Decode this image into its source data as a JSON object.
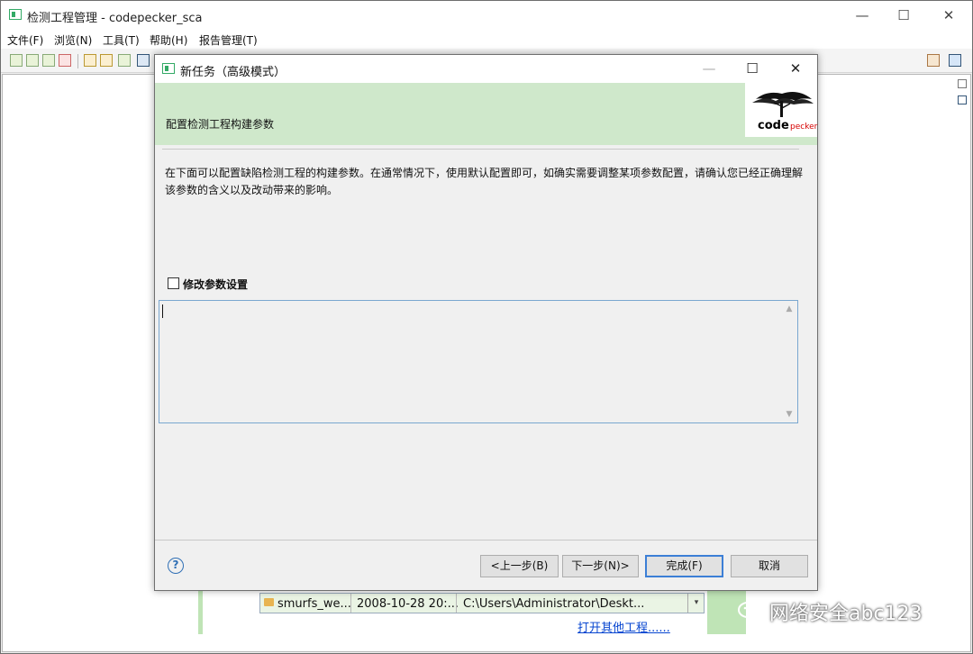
{
  "window": {
    "title": "检测工程管理 - codepecker_sca",
    "minimize_glyph": "—",
    "maximize_glyph": "☐",
    "close_glyph": "✕"
  },
  "menubar": {
    "items": [
      "文件(F)",
      "浏览(N)",
      "工具(T)",
      "帮助(H)",
      "报告管理(T)"
    ]
  },
  "background_project": {
    "row": {
      "name": "smurfs_we...",
      "date": "2008-10-28 20:...",
      "path": "C:\\Users\\Administrator\\Deskt..."
    },
    "dropdown_glyph": "▾",
    "open_other_link": "打开其他工程......"
  },
  "dialog": {
    "title": "新任务（高级模式）",
    "banner_title": "配置检测工程构建参数",
    "description": "在下面可以配置缺陷检测工程的构建参数。在通常情况下，使用默认配置即可，如确实需要调整某项参数配置，请确认您已经正确理解该参数的含义以及改动带来的影响。",
    "checkbox_label": "修改参数设置",
    "checkbox_checked": false,
    "params_text": "",
    "help_glyph": "?",
    "buttons": {
      "back": "<上一步(B)",
      "next": "下一步(N)>",
      "finish": "完成(F)",
      "cancel": "取消"
    },
    "logo": {
      "text": "code",
      "sub": "pecker"
    }
  },
  "watermark": {
    "text": "网络安全abc123"
  },
  "colors": {
    "banner": "#cfe8cb",
    "accent_button_border": "#3c7fd6",
    "link": "#0645d0",
    "logo_red": "#d60000"
  }
}
